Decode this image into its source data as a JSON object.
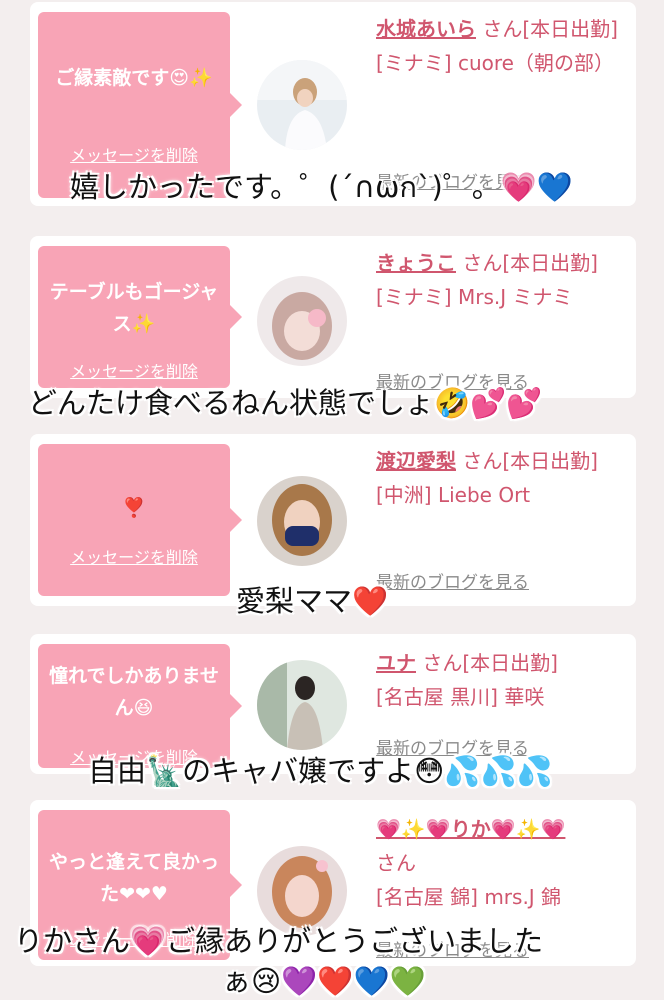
{
  "cards": [
    {
      "message": "ご縁素敵です😍✨",
      "delete_label": "メッセージを削除",
      "name": "水城あいら",
      "honorific": "さん[本日出勤]",
      "shop": "[ミナミ] cuore（朝の部）",
      "blog_label": "最新のブログを見る"
    },
    {
      "message": "テーブルもゴージャス✨",
      "delete_label": "メッセージを削除",
      "name": "きょうこ",
      "honorific": "さん[本日出勤]",
      "shop": "[ミナミ] Mrs.J ミナミ",
      "blog_label": "最新のブログを見る"
    },
    {
      "message": "❣️",
      "delete_label": "メッセージを削除",
      "name": "渡辺愛梨",
      "honorific": "さん[本日出勤]",
      "shop": "[中洲] Liebe Ort",
      "blog_label": "最新のブログを見る"
    },
    {
      "message": "憧れでしかありません😆",
      "delete_label": "メッセージを削除",
      "name": "ユナ",
      "honorific": "さん[本日出勤]",
      "shop": "[名古屋 黒川] 華咲",
      "blog_label": "最新のブログを見る"
    },
    {
      "message": "やっと逢えて良かった❤❤♥",
      "delete_label": "メッセージを削除",
      "name": "💗✨💗りか💗✨💗",
      "honorific": "さん",
      "shop": "[名古屋 錦] mrs.J 錦",
      "blog_label": "最新のブログを見る"
    }
  ],
  "captions": [
    "嬉しかったです。゜(´∩ωก`)゜。💗💙",
    "どんたけ食べるねん状態でしょ🤣💕💕",
    "愛梨ママ❤️",
    "自由🗽のキャバ嬢ですよ😳💦💦💦",
    "りかさん💗ご縁ありがとうございました",
    "ぁ😢💜❤️💙💚"
  ],
  "colors": {
    "background": "#f3eeee",
    "card": "#ffffff",
    "bubble": "#f8a4b6",
    "name_pink": "#d0566e",
    "link_gray": "#8a8a8a"
  }
}
